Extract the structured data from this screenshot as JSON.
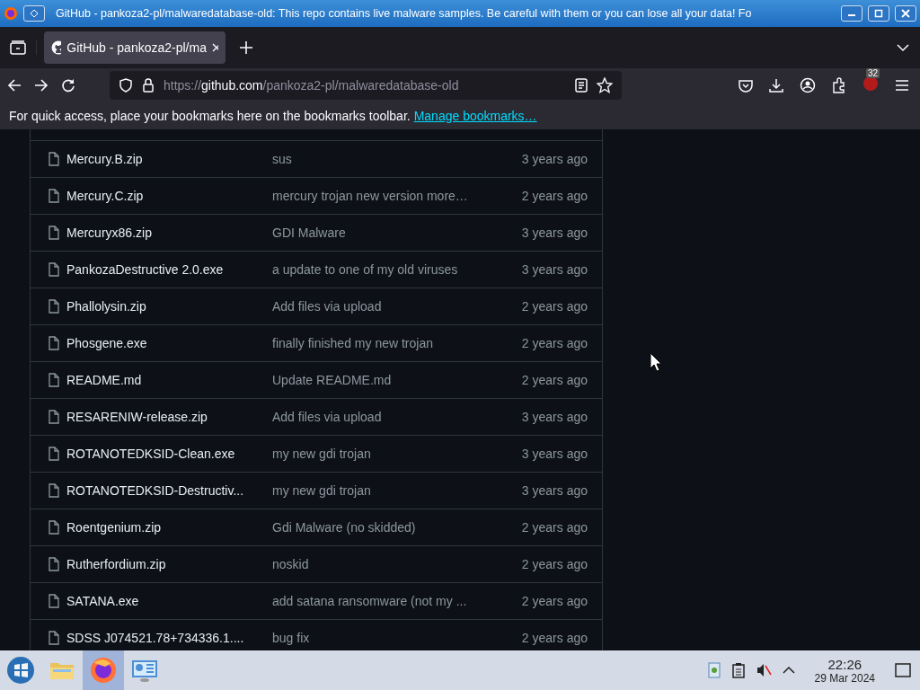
{
  "window": {
    "title": "GitHub - pankoza2-pl/malwaredatabase-old: This repo contains live malware samples. Be careful with them or you can lose all your data! Fo"
  },
  "tabs": [
    {
      "label": "GitHub - pankoza2-pl/ma",
      "selected": true
    }
  ],
  "address_bar": {
    "scheme": "https://",
    "host": "github.com",
    "path": "/pankoza2-pl/malwaredatabase-old"
  },
  "extension_badge": "32",
  "bookmarks_bar": {
    "message": "For quick access, place your bookmarks here on the bookmarks toolbar.",
    "link": "Manage bookmarks…"
  },
  "files": [
    {
      "name": "Mercury.B.zip",
      "message": "sus",
      "time": "3 years ago"
    },
    {
      "name": "Mercury.C.zip",
      "message": "mercury trojan new version more…",
      "time": "2 years ago"
    },
    {
      "name": "Mercuryx86.zip",
      "message": "GDI Malware",
      "time": "3 years ago"
    },
    {
      "name": "PankozaDestructive 2.0.exe",
      "message": "a update to one of my old viruses",
      "time": "3 years ago"
    },
    {
      "name": "Phallolysin.zip",
      "message": "Add files via upload",
      "time": "2 years ago"
    },
    {
      "name": "Phosgene.exe",
      "message": "finally finished my new trojan",
      "time": "2 years ago"
    },
    {
      "name": "README.md",
      "message": "Update README.md",
      "time": "2 years ago"
    },
    {
      "name": "RESARENIW-release.zip",
      "message": "Add files via upload",
      "time": "3 years ago"
    },
    {
      "name": "ROTANOTEDKSID-Clean.exe",
      "message": "my new gdi trojan",
      "time": "3 years ago"
    },
    {
      "name": "ROTANOTEDKSID-Destructiv...",
      "message": "my new gdi trojan",
      "time": "3 years ago"
    },
    {
      "name": "Roentgenium.zip",
      "message": "Gdi Malware (no skidded)",
      "time": "2 years ago"
    },
    {
      "name": "Rutherfordium.zip",
      "message": "noskid",
      "time": "2 years ago"
    },
    {
      "name": "SATANA.exe",
      "message": "add satana ransomware (not my ...",
      "time": "2 years ago"
    },
    {
      "name": "SDSS J074521.78+734336.1....",
      "message": "bug fix",
      "time": "2 years ago"
    }
  ],
  "taskbar": {
    "apps": [
      {
        "kind": "folder",
        "selected": false
      },
      {
        "kind": "browser",
        "selected": true
      },
      {
        "kind": "monitor",
        "selected": false
      }
    ],
    "time": "22:26",
    "date": "29 Mar 2024"
  }
}
